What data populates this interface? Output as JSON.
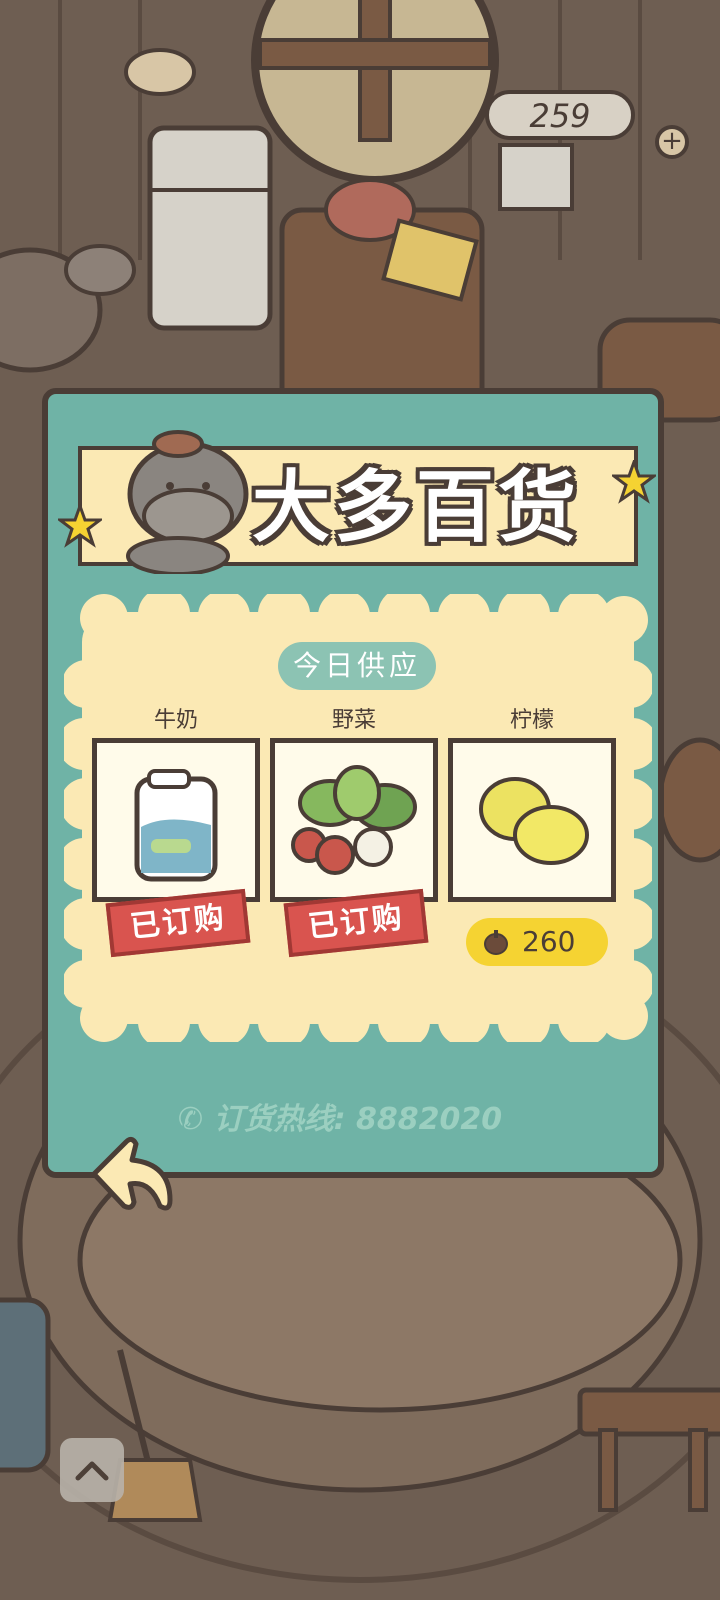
{
  "counter": {
    "value": "259",
    "plus_label": "+"
  },
  "shop": {
    "title": "大多百货",
    "section_title": "今日供应",
    "items": [
      {
        "name": "牛奶",
        "icon": "milk-carton-icon",
        "status": "已订购"
      },
      {
        "name": "野菜",
        "icon": "vegetables-icon",
        "status": "已订购"
      },
      {
        "name": "柠檬",
        "icon": "lemons-icon",
        "price": "260",
        "currency_icon": "acorn-icon"
      }
    ],
    "hotline": "订货热线: 8882020"
  },
  "colors": {
    "modal_bg": "#6fb3a6",
    "panel_bg": "#fbe9b4",
    "stamp_red": "#d9544f",
    "price_yellow": "#f5d332",
    "outline": "#4a3d36"
  }
}
